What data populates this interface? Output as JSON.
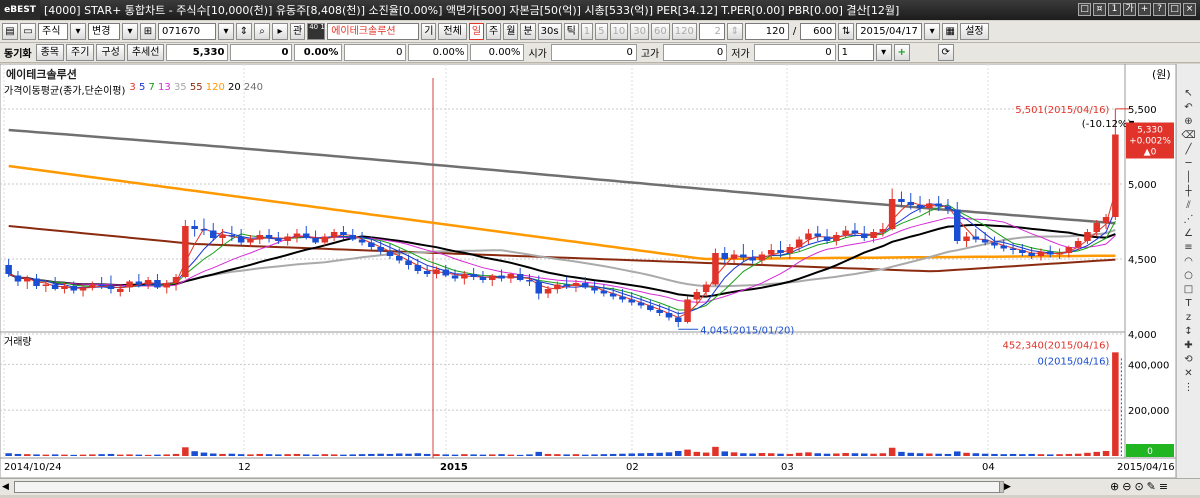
{
  "window": {
    "logo": "eBEST",
    "title": "[4000] STAR+ 통합차트 - 주식수[10,000(천)] 유동주[8,408(천)] 소진율[0.00%] 액면가[500] 자본금[50(억)] 시총[533(억)] PER[34.12] T.PER[0.00] PBR[0.00] 결산[12월]",
    "controls": [
      "□",
      "¤",
      "1",
      "가",
      "+",
      "?",
      "□",
      "×"
    ]
  },
  "toolbar1": {
    "market": "주식",
    "change_label": "변경",
    "code": "071670",
    "kwan": "관",
    "badge": "40 100",
    "stock_name": "에이테크솔루션",
    "gi": "기",
    "all": "전체",
    "periods": [
      "일",
      "주",
      "월",
      "분",
      "30s",
      "틱"
    ],
    "active_period": "일",
    "interval_options": [
      "1",
      "5",
      "10",
      "30",
      "60",
      "120"
    ],
    "interval_value": "2",
    "count": "120",
    "max_count": "600",
    "date": "2015/04/17",
    "settings": "설정"
  },
  "toolbar2": {
    "sync_label": "동기화",
    "btn_item": "종목",
    "btn_period": "주기",
    "btn_compose": "구성",
    "btn_trend": "추세선",
    "price": "5,330",
    "change": "0",
    "change_pct": "0.00%",
    "f1": "0",
    "f1_pct": "0.00%",
    "f2_pct": "0.00%",
    "open_label": "시가",
    "open": "0",
    "high_label": "고가",
    "high": "0",
    "low_label": "저가",
    "low": "0",
    "lines": "1"
  },
  "chart": {
    "stock_name": "에이테크솔루션",
    "unit": "(원)",
    "ma_title": "가격이동평균(종가,단순이평)",
    "ma_periods": [
      "3",
      "5",
      "7",
      "13",
      "35",
      "55",
      "120",
      "20",
      "240"
    ],
    "ma_colors": [
      "#e0342a",
      "#1a34d4",
      "#17a017",
      "#d62ad6",
      "#aaaaaa",
      "#8a2a0e",
      "#ff9900",
      "#000000",
      "#707070"
    ],
    "volume_title": "거래량",
    "high_annotation": "5,501(2015/04/16)",
    "high_pct": "(-10.12%)",
    "low_annotation": "4,045(2015/01/20)",
    "vol_annotation": "452,340(2015/04/16)",
    "vol_annotation2": "0(2015/04/16)",
    "current_price": "5,330",
    "current_change": "+0.002%",
    "current_delta": "▲0",
    "current_volume": "0",
    "accent_up": "#e0342a",
    "accent_down": "#1a4fd4"
  },
  "chart_data": {
    "type": "candlestick",
    "price_axis_ticks": [
      "5,500",
      "5,000",
      "4,500",
      "4,000"
    ],
    "price_ylim": [
      4000,
      5600
    ],
    "volume_axis_ticks": [
      "400,000",
      "200,000"
    ],
    "volume_ylim": [
      0,
      480000
    ],
    "x_ticks": [
      "2014/10/24",
      "12",
      "2015",
      "02",
      "03",
      "04",
      "2015/04/16"
    ],
    "last_volume": 452340,
    "candles": [
      [
        4460,
        4500,
        4380,
        4400
      ],
      [
        4390,
        4420,
        4320,
        4350
      ],
      [
        4350,
        4390,
        4300,
        4370
      ],
      [
        4370,
        4400,
        4300,
        4320
      ],
      [
        4320,
        4360,
        4280,
        4330
      ],
      [
        4330,
        4380,
        4290,
        4300
      ],
      [
        4300,
        4340,
        4270,
        4320
      ],
      [
        4320,
        4350,
        4270,
        4290
      ],
      [
        4290,
        4330,
        4250,
        4310
      ],
      [
        4310,
        4350,
        4290,
        4330
      ],
      [
        4330,
        4380,
        4300,
        4320
      ],
      [
        4320,
        4390,
        4270,
        4300
      ],
      [
        4280,
        4330,
        4250,
        4300
      ],
      [
        4310,
        4360,
        4280,
        4350
      ],
      [
        4350,
        4400,
        4310,
        4330
      ],
      [
        4330,
        4380,
        4300,
        4360
      ],
      [
        4360,
        4400,
        4300,
        4310
      ],
      [
        4310,
        4360,
        4270,
        4340
      ],
      [
        4340,
        4400,
        4290,
        4380
      ],
      [
        4380,
        4760,
        4370,
        4720
      ],
      [
        4720,
        4760,
        4650,
        4700
      ],
      [
        4700,
        4770,
        4660,
        4690
      ],
      [
        4690,
        4740,
        4620,
        4640
      ],
      [
        4640,
        4700,
        4600,
        4660
      ],
      [
        4660,
        4720,
        4620,
        4650
      ],
      [
        4650,
        4700,
        4590,
        4610
      ],
      [
        4610,
        4660,
        4580,
        4630
      ],
      [
        4630,
        4690,
        4600,
        4660
      ],
      [
        4660,
        4700,
        4610,
        4640
      ],
      [
        4640,
        4680,
        4600,
        4620
      ],
      [
        4620,
        4670,
        4590,
        4650
      ],
      [
        4650,
        4700,
        4610,
        4670
      ],
      [
        4670,
        4720,
        4630,
        4640
      ],
      [
        4640,
        4690,
        4600,
        4610
      ],
      [
        4610,
        4670,
        4590,
        4650
      ],
      [
        4650,
        4700,
        4620,
        4680
      ],
      [
        4680,
        4720,
        4630,
        4660
      ],
      [
        4660,
        4700,
        4620,
        4630
      ],
      [
        4630,
        4680,
        4590,
        4610
      ],
      [
        4610,
        4650,
        4560,
        4580
      ],
      [
        4580,
        4620,
        4530,
        4550
      ],
      [
        4550,
        4600,
        4500,
        4520
      ],
      [
        4520,
        4570,
        4470,
        4490
      ],
      [
        4490,
        4530,
        4430,
        4460
      ],
      [
        4460,
        4500,
        4400,
        4420
      ],
      [
        4420,
        4460,
        4380,
        4400
      ],
      [
        4400,
        4450,
        4370,
        4430
      ],
      [
        4430,
        4460,
        4380,
        4390
      ],
      [
        4390,
        4430,
        4350,
        4370
      ],
      [
        4370,
        4420,
        4330,
        4400
      ],
      [
        4400,
        4440,
        4360,
        4380
      ],
      [
        4380,
        4420,
        4340,
        4360
      ],
      [
        4360,
        4400,
        4320,
        4390
      ],
      [
        4390,
        4430,
        4350,
        4370
      ],
      [
        4370,
        4410,
        4340,
        4400
      ],
      [
        4400,
        4440,
        4350,
        4360
      ],
      [
        4360,
        4400,
        4320,
        4350
      ],
      [
        4350,
        4390,
        4230,
        4270
      ],
      [
        4270,
        4320,
        4240,
        4300
      ],
      [
        4300,
        4350,
        4270,
        4330
      ],
      [
        4330,
        4380,
        4300,
        4320
      ],
      [
        4320,
        4360,
        4280,
        4340
      ],
      [
        4340,
        4380,
        4300,
        4310
      ],
      [
        4310,
        4350,
        4270,
        4290
      ],
      [
        4290,
        4330,
        4250,
        4270
      ],
      [
        4270,
        4310,
        4230,
        4250
      ],
      [
        4250,
        4300,
        4210,
        4230
      ],
      [
        4230,
        4280,
        4190,
        4210
      ],
      [
        4210,
        4250,
        4170,
        4190
      ],
      [
        4190,
        4230,
        4150,
        4160
      ],
      [
        4160,
        4200,
        4120,
        4140
      ],
      [
        4140,
        4180,
        4090,
        4110
      ],
      [
        4110,
        4150,
        4045,
        4080
      ],
      [
        4080,
        4250,
        4070,
        4230
      ],
      [
        4230,
        4300,
        4200,
        4280
      ],
      [
        4280,
        4350,
        4250,
        4330
      ],
      [
        4330,
        4570,
        4320,
        4540
      ],
      [
        4540,
        4580,
        4470,
        4500
      ],
      [
        4500,
        4560,
        4470,
        4530
      ],
      [
        4530,
        4600,
        4480,
        4510
      ],
      [
        4510,
        4560,
        4470,
        4490
      ],
      [
        4490,
        4550,
        4460,
        4530
      ],
      [
        4530,
        4600,
        4500,
        4560
      ],
      [
        4560,
        4620,
        4510,
        4540
      ],
      [
        4540,
        4600,
        4500,
        4580
      ],
      [
        4580,
        4650,
        4550,
        4630
      ],
      [
        4630,
        4700,
        4600,
        4670
      ],
      [
        4670,
        4720,
        4620,
        4650
      ],
      [
        4650,
        4700,
        4600,
        4620
      ],
      [
        4620,
        4680,
        4590,
        4660
      ],
      [
        4660,
        4720,
        4640,
        4690
      ],
      [
        4690,
        4740,
        4650,
        4670
      ],
      [
        4670,
        4720,
        4620,
        4640
      ],
      [
        4640,
        4700,
        4610,
        4680
      ],
      [
        4680,
        4740,
        4650,
        4700
      ],
      [
        4700,
        4970,
        4690,
        4900
      ],
      [
        4900,
        4950,
        4850,
        4880
      ],
      [
        4880,
        4940,
        4830,
        4860
      ],
      [
        4860,
        4920,
        4810,
        4840
      ],
      [
        4840,
        4900,
        4790,
        4870
      ],
      [
        4870,
        4920,
        4820,
        4850
      ],
      [
        4850,
        4900,
        4800,
        4830
      ],
      [
        4830,
        4880,
        4600,
        4620
      ],
      [
        4620,
        4680,
        4580,
        4650
      ],
      [
        4650,
        4700,
        4610,
        4630
      ],
      [
        4630,
        4680,
        4590,
        4610
      ],
      [
        4610,
        4650,
        4570,
        4590
      ],
      [
        4590,
        4630,
        4550,
        4570
      ],
      [
        4570,
        4610,
        4530,
        4560
      ],
      [
        4560,
        4600,
        4520,
        4540
      ],
      [
        4540,
        4580,
        4500,
        4520
      ],
      [
        4520,
        4570,
        4490,
        4550
      ],
      [
        4550,
        4590,
        4510,
        4530
      ],
      [
        4530,
        4570,
        4500,
        4540
      ],
      [
        4540,
        4590,
        4510,
        4580
      ],
      [
        4580,
        4640,
        4560,
        4620
      ],
      [
        4620,
        4700,
        4600,
        4680
      ],
      [
        4680,
        4760,
        4650,
        4740
      ],
      [
        4740,
        4800,
        4700,
        4780
      ],
      [
        4780,
        5501,
        4760,
        5330
      ]
    ],
    "volumes": [
      12000,
      9000,
      8000,
      7000,
      6000,
      7000,
      6000,
      5000,
      6000,
      7000,
      8000,
      9000,
      6000,
      7000,
      6000,
      5000,
      6000,
      7000,
      9000,
      38000,
      21000,
      15000,
      11000,
      9000,
      10000,
      8000,
      7000,
      9000,
      8000,
      7000,
      8000,
      9000,
      7000,
      6000,
      8000,
      7000,
      6000,
      7000,
      8000,
      9000,
      10000,
      9000,
      11000,
      10000,
      12000,
      9000,
      8000,
      7000,
      6000,
      8000,
      7000,
      6000,
      7000,
      8000,
      6000,
      5000,
      7000,
      18000,
      9000,
      8000,
      7000,
      8000,
      6000,
      7000,
      8000,
      9000,
      10000,
      11000,
      12000,
      13000,
      14000,
      16000,
      22000,
      28000,
      18000,
      15000,
      40000,
      20000,
      16000,
      12000,
      11000,
      13000,
      12000,
      10000,
      9000,
      14000,
      16000,
      12000,
      10000,
      11000,
      13000,
      12000,
      11000,
      10000,
      12000,
      36000,
      18000,
      14000,
      12000,
      11000,
      10000,
      9000,
      20000,
      14000,
      12000,
      10000,
      9000,
      8000,
      9000,
      8000,
      9000,
      8000,
      7000,
      8000,
      9000,
      10000,
      14000,
      18000,
      22000,
      452340
    ]
  }
}
